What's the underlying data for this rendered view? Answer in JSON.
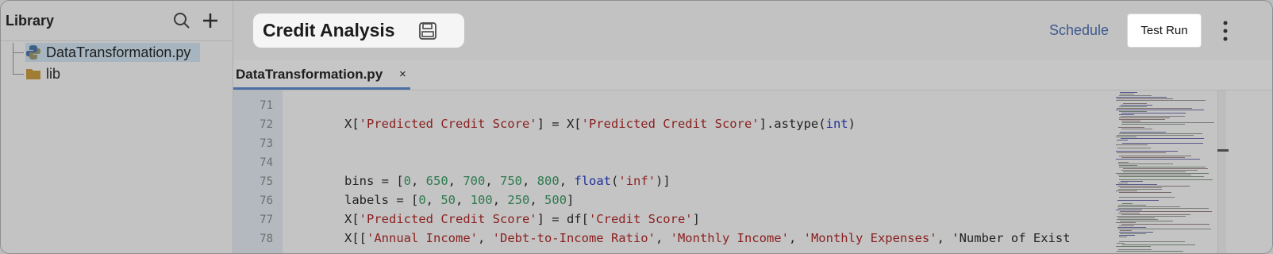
{
  "sidebar": {
    "title": "Library",
    "files": [
      {
        "name": "DataTransformation.py",
        "icon": "python-file-icon",
        "selected": true
      },
      {
        "name": "lib",
        "icon": "folder-icon",
        "selected": false
      }
    ]
  },
  "header": {
    "title": "Credit Analysis",
    "schedule_label": "Schedule",
    "test_run_label": "Test Run"
  },
  "editor": {
    "tab_label": "DataTransformation.py",
    "tab_close": "×",
    "lines": [
      {
        "num": "71",
        "code": ""
      },
      {
        "num": "72",
        "code": "X['Predicted Credit Score'] = X['Predicted Credit Score'].astype(int)"
      },
      {
        "num": "73",
        "code": ""
      },
      {
        "num": "74",
        "code": ""
      },
      {
        "num": "75",
        "code": "bins = [0, 650, 700, 750, 800, float('inf')]"
      },
      {
        "num": "76",
        "code": "labels = [0, 50, 100, 250, 500]"
      },
      {
        "num": "77",
        "code": "X['Predicted Credit Score'] = df['Credit Score']"
      },
      {
        "num": "78",
        "code": "X[['Annual Income', 'Debt-to-Income Ratio', 'Monthly Income', 'Monthly Expenses', 'Number of Exist"
      }
    ]
  },
  "colors": {
    "accent": "#4a6fa5",
    "string": "#8a1f1f",
    "number": "#2e7a4e",
    "keyword": "#1f2f9a",
    "selected_item": "#a6b5c0"
  }
}
